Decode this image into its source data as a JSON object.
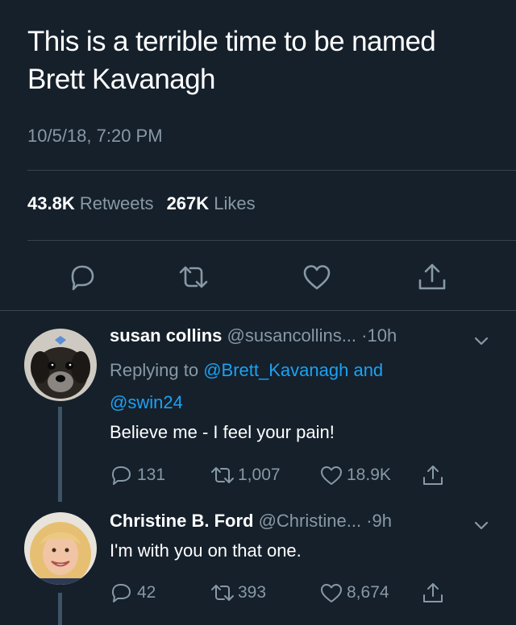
{
  "tweet": {
    "text_line1": "This is a terrible time to be named",
    "text_line2": "Brett Kavanagh",
    "timestamp": "10/5/18, 7:20 PM",
    "retweets_count": "43.8K",
    "retweets_label": "Retweets",
    "likes_count": "267K",
    "likes_label": "Likes"
  },
  "actions": {
    "reply_icon": "reply-icon",
    "retweet_icon": "retweet-icon",
    "like_icon": "heart-icon",
    "share_icon": "share-icon"
  },
  "replies": [
    {
      "name": "susan collins",
      "handle": "@susancollins...",
      "time": "·10h",
      "replying_prefix": "Replying to",
      "replying_to_1": "@Brett_Kavanagh",
      "replying_and": "and",
      "replying_to_2": "@swin24",
      "body": "Believe me - I feel your pain!",
      "reply_count": "131",
      "retweet_count": "1,007",
      "like_count": "18.9K"
    },
    {
      "name": "Christine B. Ford",
      "handle": "@Christine...",
      "time": "·9h",
      "body": "I'm with you on that one.",
      "reply_count": "42",
      "retweet_count": "393",
      "like_count": "8,674"
    }
  ],
  "colors": {
    "background": "#15202b",
    "muted": "#8899a6",
    "link": "#1da1f2",
    "divider": "#38444d"
  }
}
